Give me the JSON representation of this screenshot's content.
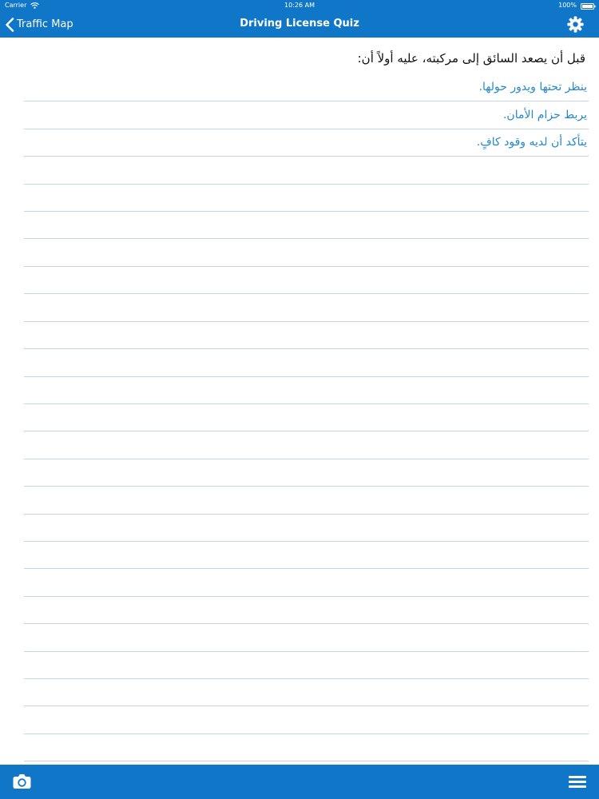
{
  "status_bar": {
    "carrier": "Carrier",
    "time": "10:26 AM",
    "battery": "100%"
  },
  "nav": {
    "back_label": "Traffic Map",
    "title": "Driving License Quiz",
    "settings_icon": "gear-icon",
    "back_icon": "chevron-left-icon"
  },
  "quiz": {
    "question": "قبل أن يصعد السائق إلى مركبته، عليه أولاً أن:",
    "answers": [
      "ينظر تحتها ويدور حولها.",
      "يربط حزام الأمان.",
      "يتأكد أن لديه وقود كافٍ."
    ]
  },
  "toolbar": {
    "camera_icon": "camera-icon",
    "menu_icon": "menu-icon"
  },
  "colors": {
    "primary": "#0f76c8",
    "answer_text": "#2588c9",
    "question_text": "#111111",
    "separator": "#c9d3dd",
    "background": "#ffffff"
  }
}
